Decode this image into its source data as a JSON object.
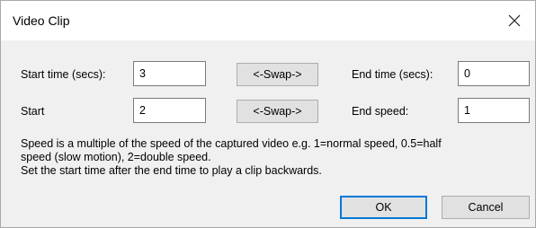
{
  "window": {
    "title": "Video Clip"
  },
  "row1": {
    "start_label": "Start time (secs):",
    "start_value": "3",
    "swap_label": "<-Swap->",
    "end_label": "End time (secs):",
    "end_value": "0"
  },
  "row2": {
    "start_label": "Start",
    "start_value": "2",
    "swap_label": "<-Swap->",
    "end_label": "End speed:",
    "end_value": "1"
  },
  "help": {
    "line1": "Speed is a multiple of the speed of the captured video e.g. 1=normal speed, 0.5=half",
    "line2": "speed (slow motion), 2=double speed.",
    "line3": "Set the start time after the end time to play a clip backwards."
  },
  "buttons": {
    "ok": "OK",
    "cancel": "Cancel"
  },
  "icons": {
    "close": "close-icon"
  }
}
